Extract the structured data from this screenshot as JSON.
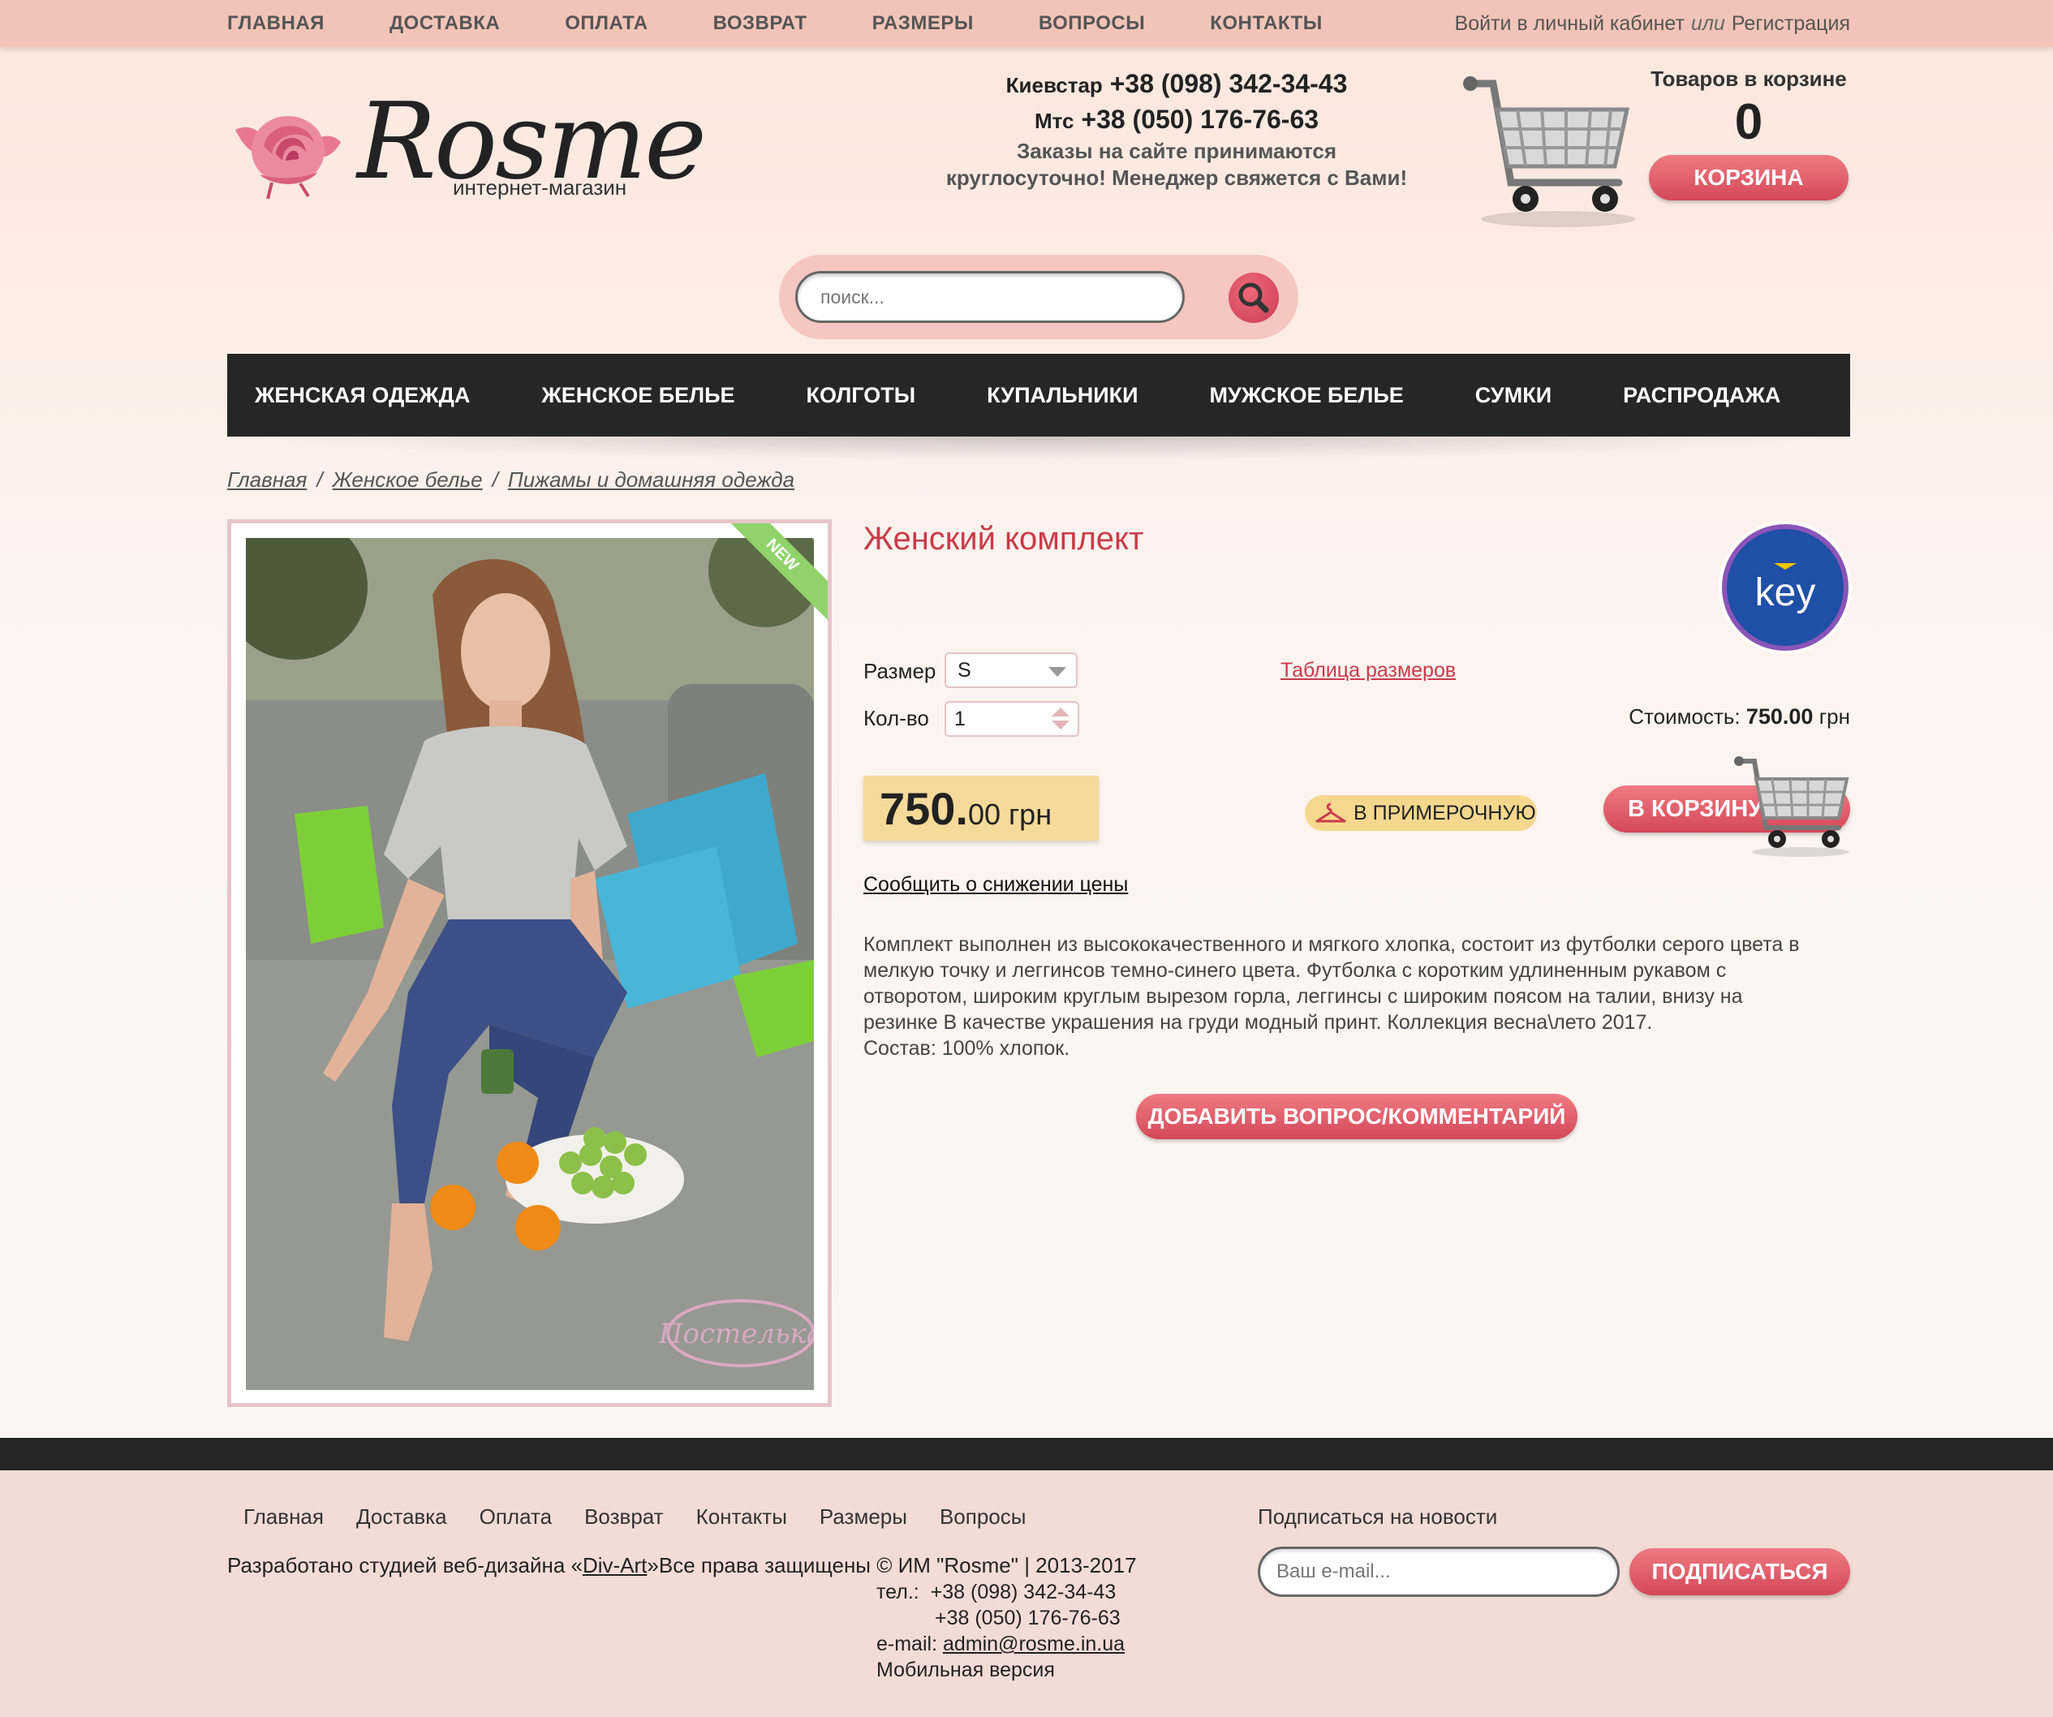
{
  "colors": {
    "topbar": "#f2c4b9",
    "accent_red": "#d4485a",
    "title_red": "#c93b4a",
    "menu_bg": "#262626",
    "price_bg": "#f6da9a"
  },
  "topnav": {
    "items": [
      "ГЛАВНАЯ",
      "ДОСТАВКА",
      "ОПЛАТА",
      "ВОЗВРАТ",
      "РАЗМЕРЫ",
      "ВОПРОСЫ",
      "КОНТАКТЫ"
    ],
    "login_label": "Войти в личный кабинет",
    "or_label": "или",
    "register_label": "Регистрация"
  },
  "header": {
    "logo_text": "Rosme",
    "logo_subtitle": "интернет-магазин",
    "phone1_operator": "Киевстар",
    "phone1_number": "+38 (098) 342-34-43",
    "phone2_operator": "Мтс",
    "phone2_number": "+38 (050) 176-76-63",
    "note_line1": "Заказы на сайте принимаются",
    "note_line2": "круглосуточно!  Менеджер свяжется с Вами!",
    "cart_title": "Товаров в корзине",
    "cart_count": "0",
    "cart_button": "КОРЗИНА",
    "icons": [
      "rose-logo-icon",
      "shopping-cart-icon"
    ]
  },
  "search": {
    "placeholder": "поиск...",
    "icon": "search-icon"
  },
  "mainmenu": {
    "items": [
      "ЖЕНСКАЯ ОДЕЖДА",
      "ЖЕНСКОЕ БЕЛЬЕ",
      "КОЛГОТЫ",
      "КУПАЛЬНИКИ",
      "МУЖСКОЕ БЕЛЬЕ",
      "СУМКИ",
      "РАСПРОДАЖА"
    ]
  },
  "breadcrumb": {
    "items": [
      "Главная",
      "Женское белье",
      "Пижамы и домашняя одежда"
    ],
    "separator": "/"
  },
  "product": {
    "ribbon": "NEW",
    "photo_watermark": "Постелька",
    "title": "Женский комплект",
    "brand_logo_text": "key",
    "size_label": "Размер",
    "size_value": "S",
    "size_table_link": "Таблица размеров",
    "qty_label": "Кол-во",
    "qty_value": "1",
    "cost_label": "Стоимость:",
    "cost_value": "750.00",
    "cost_currency": "грн",
    "price_main": "750.",
    "price_cents": "00 грн",
    "fitting_button": "В ПРИМЕРОЧНУЮ",
    "to_cart_button": "В КОРЗИНУ",
    "notify_link": "Сообщить о снижении цены",
    "description": [
      "Комплект выполнен из высококачественного и мягкого хлопка, состоит из футболки серого цвета в",
      "мелкую точку и леггинсов темно-синего цвета. Футболка с коротким удлиненным рукавом с",
      "отворотом, широким круглым вырезом горла, леггинсы с широким поясом на талии, внизу на",
      "резинке В качестве украшения на груди модный принт. Коллекция весна\\лето 2017.",
      "Состав: 100% хлопок."
    ],
    "comment_button": "ДОБАВИТЬ ВОПРОС/КОММЕНТАРИЙ",
    "icons": [
      "hanger-icon",
      "shopping-cart-icon",
      "brand-key-logo-icon"
    ]
  },
  "footer": {
    "nav": [
      "Главная",
      "Доставка",
      "Оплата",
      "Возврат",
      "Контакты",
      "Размеры",
      "Вопросы"
    ],
    "copy_prefix": "Разработано студией веб-дизайна «",
    "copy_link": "Div-Art",
    "copy_suffix": "»Все права защищены © ИМ \"Rosme\" | 2013-2017",
    "tel_label": "тел.:",
    "tel1": "+38 (098) 342-34-43",
    "tel2": "+38 (050) 176-76-63",
    "email_label": "e-mail:",
    "email": "admin@rosme.in.ua",
    "mobile_version": "Мобильная версия",
    "subscribe_title": "Подписаться на новости",
    "subscribe_placeholder": "Ваш e-mail...",
    "subscribe_button": "ПОДПИСАТЬСЯ"
  }
}
